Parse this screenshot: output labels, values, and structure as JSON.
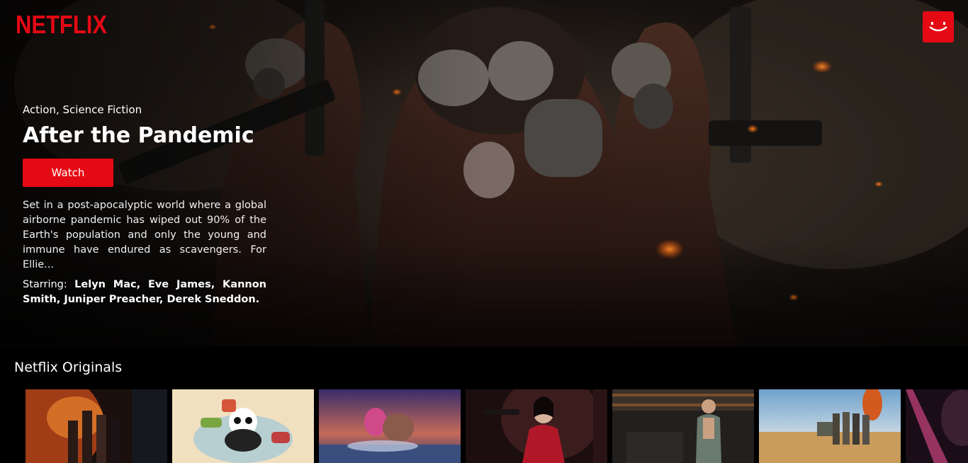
{
  "brand": {
    "logo_text": "NETFLIX",
    "color": "#e50914"
  },
  "profile": {
    "icon": "smile-avatar-icon"
  },
  "featured": {
    "genres": "Action, Science Fiction",
    "title": "After the Pandemic",
    "watch_label": "Watch",
    "description": "Set in a post-apocalyptic world where a global airborne pandemic has wiped out 90% of the Earth's population and only the young and immune have endured as scavengers. For Ellie...",
    "starring_label": "Starring:",
    "starring_cast": "Lelyn Mac, Eve James, Kannon Smith, Juniper Preacher, Derek Sneddon."
  },
  "row": {
    "title": "Netflix Originals",
    "posters": [
      {
        "icon": "desert-war-poster"
      },
      {
        "icon": "kung-fu-panda-poster"
      },
      {
        "icon": "monster-ocean-poster"
      },
      {
        "icon": "red-dress-gunwoman-poster"
      },
      {
        "icon": "bar-man-poster"
      },
      {
        "icon": "desert-squad-explosion-poster"
      },
      {
        "icon": "pink-action-poster"
      }
    ]
  }
}
